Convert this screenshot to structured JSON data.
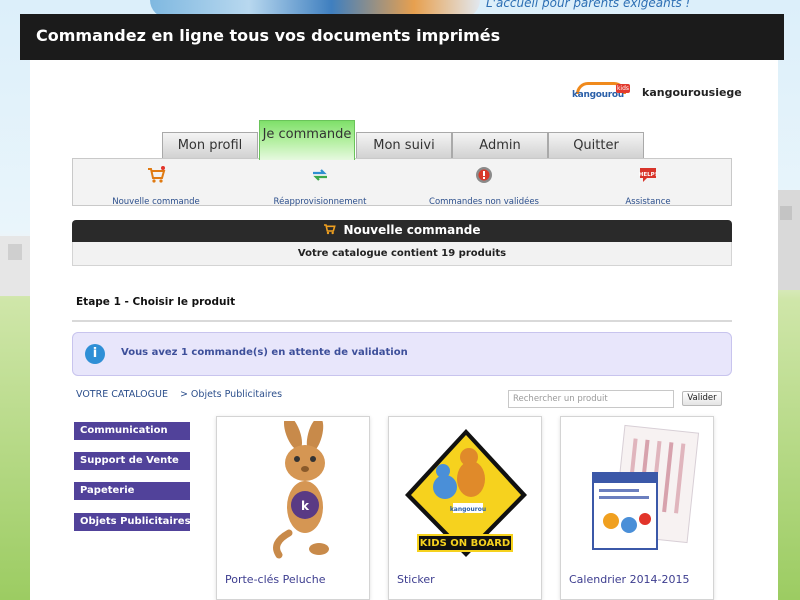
{
  "header": {
    "slogan": "L'accueil pour parents exigeants !",
    "title": "Commandez en ligne tous vos documents imprimés"
  },
  "brand": {
    "logo_text": "kangourou",
    "logo_badge": "kids",
    "username": "kangourousiege"
  },
  "tabs": [
    {
      "label": "Mon profil",
      "active": false
    },
    {
      "label": "Je commande",
      "active": true
    },
    {
      "label": "Mon suivi",
      "active": false
    },
    {
      "label": "Admin",
      "active": false
    },
    {
      "label": "Quitter",
      "active": false
    }
  ],
  "actions": [
    {
      "label": "Nouvelle commande",
      "icon": "cart-icon"
    },
    {
      "label": "Réapprovisionnement",
      "icon": "refresh-arrows-icon"
    },
    {
      "label": "Commandes non validées",
      "icon": "warning-icon"
    },
    {
      "label": "Assistance",
      "icon": "help-icon"
    }
  ],
  "section": {
    "title": "Nouvelle commande",
    "subtitle": "Votre catalogue contient 19 produits"
  },
  "step": "Etape 1 - Choisir le produit",
  "info": {
    "message": "Vous avez 1 commande(s) en attente de validation"
  },
  "breadcrumb": {
    "root": "VOTRE CATALOGUE",
    "current": "> Objets Publicitaires"
  },
  "search": {
    "placeholder": "Rechercher un produit",
    "button": "Valider"
  },
  "categories": [
    {
      "label": "Communication"
    },
    {
      "label": "Support de Vente"
    },
    {
      "label": "Papeterie"
    },
    {
      "label": "Objets Publicitaires"
    }
  ],
  "products": [
    {
      "name": "Porte-clés Peluche"
    },
    {
      "name": "Sticker",
      "image_text": "KIDS ON BOARD"
    },
    {
      "name": "Calendrier 2014-2015"
    }
  ],
  "colors": {
    "tab_active": "#8fe47a",
    "category_bg": "#51429a",
    "info_bg": "#e8e6fb",
    "header_bg": "#1b1b1b"
  }
}
